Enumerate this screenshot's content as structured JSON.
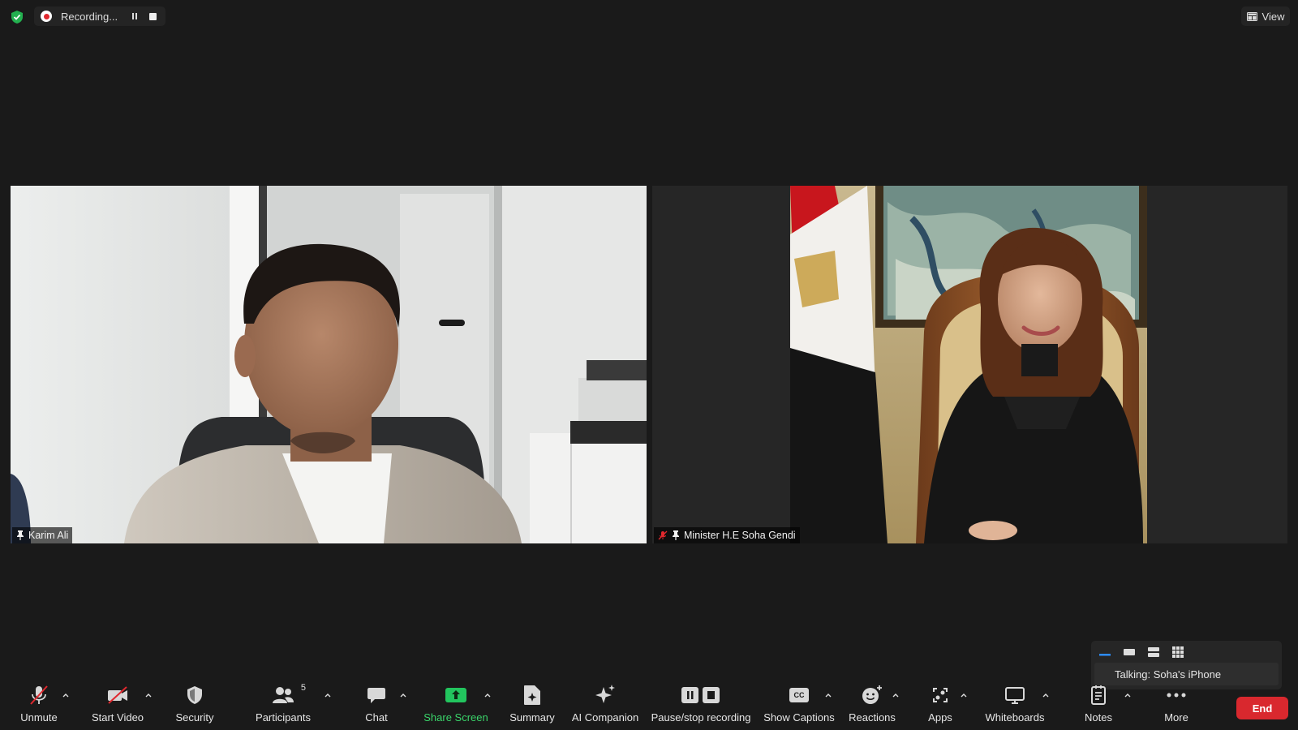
{
  "topbar": {
    "recording_label": "Recording...",
    "view_label": "View"
  },
  "participants": [
    {
      "name": "Karim Ali",
      "muted": false
    },
    {
      "name": "Minister H.E Soha Gendi",
      "muted": true
    }
  ],
  "popover": {
    "talking_label": "Talking: Soha's iPhone"
  },
  "toolbar": {
    "unmute": "Unmute",
    "start_video": "Start Video",
    "security": "Security",
    "participants": "Participants",
    "participants_count": "5",
    "chat": "Chat",
    "share_screen": "Share Screen",
    "summary": "Summary",
    "ai_companion": "AI Companion",
    "pause_stop_recording": "Pause/stop recording",
    "show_captions": "Show Captions",
    "captions_glyph": "CC",
    "reactions": "Reactions",
    "apps": "Apps",
    "whiteboards": "Whiteboards",
    "notes": "Notes",
    "more": "More",
    "end": "End"
  },
  "colors": {
    "background": "#1a1a1a",
    "end_button": "#d9282e",
    "share_green": "#22c55e",
    "recording_red": "#e0282e",
    "shield_green": "#23b04f",
    "mute_red": "#e0282e"
  }
}
